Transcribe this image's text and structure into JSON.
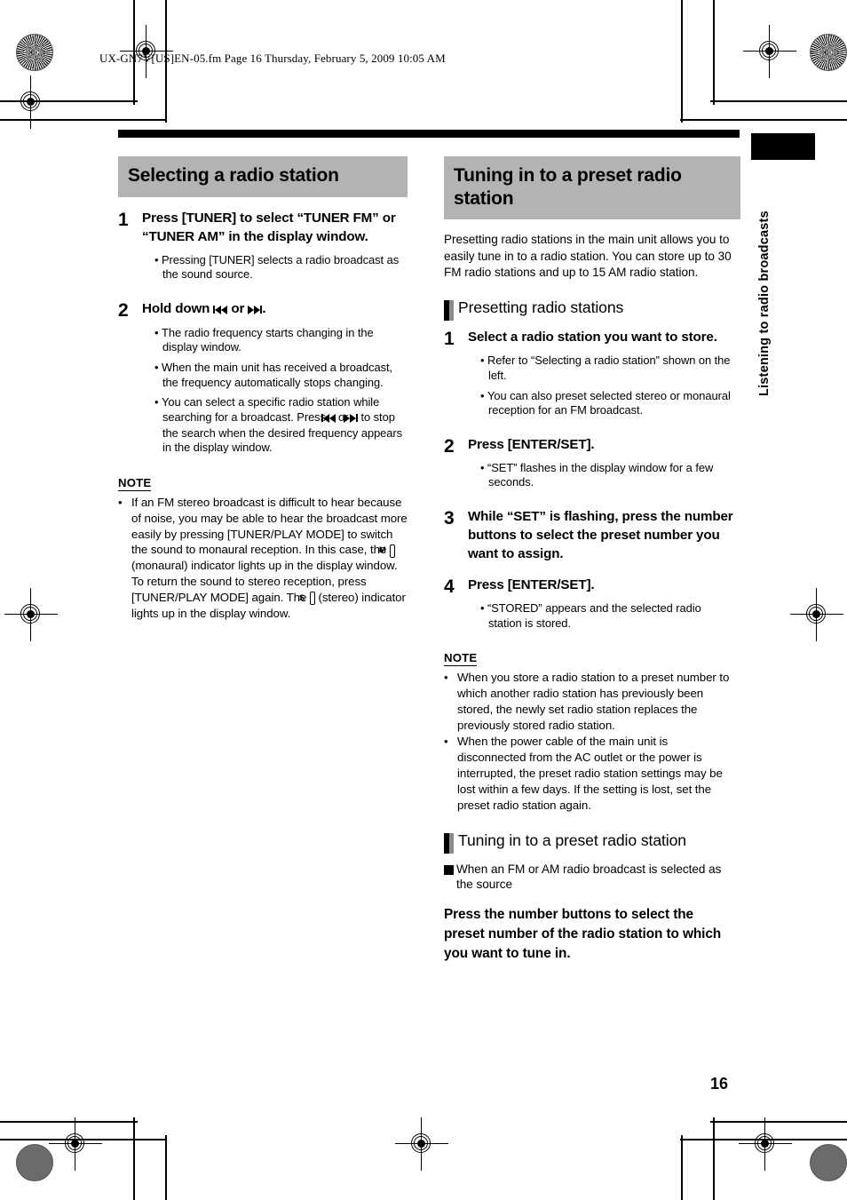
{
  "header": {
    "filename_line": "UX-GN7V[US]EN-05.fm  Page 16  Thursday, February 5, 2009  10:05 AM"
  },
  "side_tab": {
    "label": "Listening to radio broadcasts"
  },
  "page_number": "16",
  "left_column": {
    "heading": "Selecting a radio station",
    "steps": [
      {
        "number": "1",
        "title": "Press [TUNER] to select “TUNER FM” or “TUNER AM” in the display window.",
        "bullets": [
          "Pressing [TUNER] selects a radio broadcast as the sound source."
        ]
      },
      {
        "number": "2",
        "title_prefix": "Hold down ",
        "title_mid": " or ",
        "title_suffix": ".",
        "bullets": [
          "The radio frequency starts changing in the display window.",
          "When the main unit has received a broadcast, the frequency automatically stops changing."
        ],
        "bullet_split": {
          "part1": "You can select a specific radio station while searching for a broadcast. Press ",
          "part2": " or ",
          "part3": " to stop the search when the desired frequency appears in the display window."
        }
      }
    ],
    "note": {
      "title": "NOTE",
      "text_part1": "If an FM stereo broadcast is difficult to hear because of noise, you may be able to hear the broadcast more easily by pressing [TUNER/PLAY MODE] to switch the sound to monaural reception. In this case, the ",
      "indicator_mono": "M",
      "text_part2": " (monaural) indicator lights up in the display window. To return the sound to stereo reception, press [TUNER/PLAY MODE] again. The ",
      "indicator_stereo": "S",
      "text_part3": " (stereo) indicator lights up in the display window."
    }
  },
  "right_column": {
    "heading": "Tuning in to a preset radio station",
    "intro": "Presetting radio stations in the main unit allows you to easily tune in to a radio station. You can store up to 30 FM radio stations and up to 15 AM radio station.",
    "subheading_presetting": "Presetting radio stations",
    "steps": [
      {
        "number": "1",
        "title": "Select a radio station you want to store.",
        "bullets": [
          "Refer to “Selecting a radio station” shown on the left.",
          "You can also preset selected stereo or monaural reception for an FM broadcast."
        ]
      },
      {
        "number": "2",
        "title": "Press [ENTER/SET].",
        "bullets": [
          "“SET” flashes in the display window for a few seconds."
        ]
      },
      {
        "number": "3",
        "title": "While “SET” is flashing, press the number buttons to select the preset number you want to assign.",
        "bullets": []
      },
      {
        "number": "4",
        "title": "Press [ENTER/SET].",
        "bullets": [
          "“STORED” appears and the selected radio station is stored."
        ]
      }
    ],
    "note": {
      "title": "NOTE",
      "items": [
        "When you store a radio station to a preset number to which another radio station has previously been stored, the newly set radio station replaces the previously stored radio station.",
        "When the power cable of the main unit is disconnected from the AC outlet or the power is interrupted, the preset radio station settings may be lost within a few days. If the setting is lost, set the preset radio station again."
      ]
    },
    "subheading_tuning": "Tuning in to a preset radio station",
    "square_item": "When an FM or AM radio broadcast is selected as the source",
    "instruction": "Press the number buttons to select the preset number of the radio station to which you want to tune in."
  },
  "colors": {
    "heading_band": "#b3b3b3",
    "rule": "#000000",
    "sub_marker_dark": "#000000",
    "sub_marker_light": "#8c8c8c"
  }
}
